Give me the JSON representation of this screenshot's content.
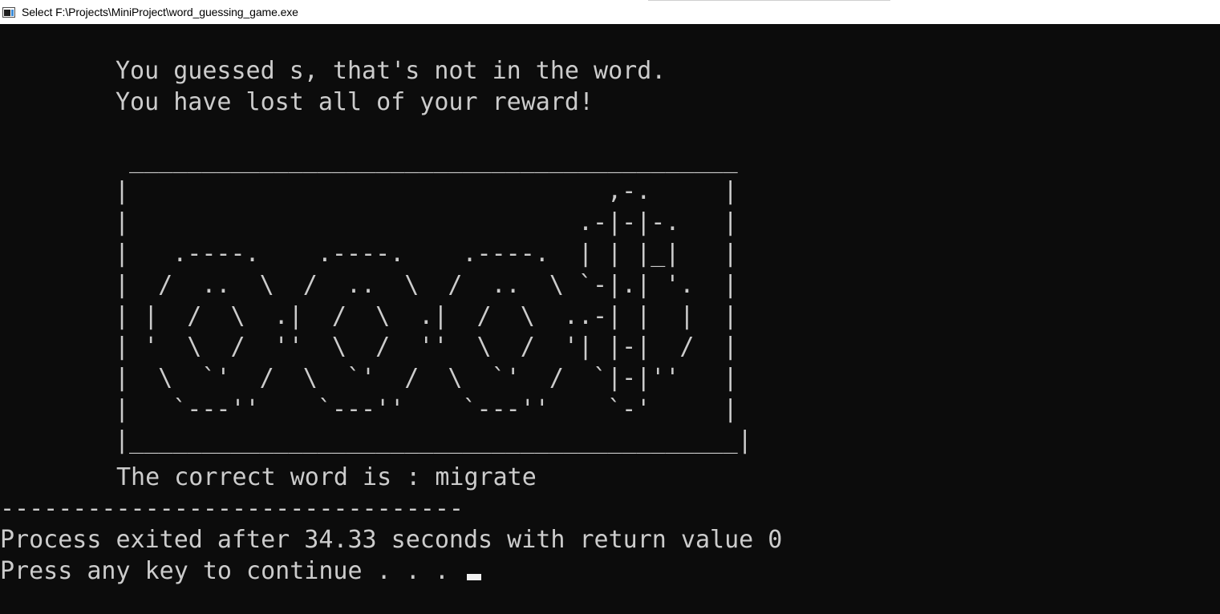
{
  "window": {
    "title": "Select F:\\Projects\\MiniProject\\word_guessing_game.exe",
    "app_icon": "console-window-icon"
  },
  "console": {
    "message_1": "You guessed s, that's not in the word.",
    "message_2": "You have lost all of your reward!",
    "ascii_art": " __________________________________________\n|                                 ,-.     |\n|                               .-|-|-.   |\n|   .----.    .----.    .----.  | | |_|   |\n|  /  ..  \\  /  ..  \\  /  ..  \\ `-|.| '.  |\n| |  /  \\  .|  /  \\  .|  /  \\  ..-| |  |  |\n| '  \\  /  ''  \\  /  ''  \\  /  '| |-|  /  |\n|  \\  `'  /  \\  `'  /  \\  `'  /  `|-|''   |\n|   `---''    `---''    `---''    `-'     |\n|__________________________________________|",
    "correct_word_line": "The correct word is : migrate",
    "separator": "--------------------------------",
    "process_line": "Process exited after 34.33 seconds with return value 0",
    "continue_prompt": "Press any key to continue . . . "
  }
}
